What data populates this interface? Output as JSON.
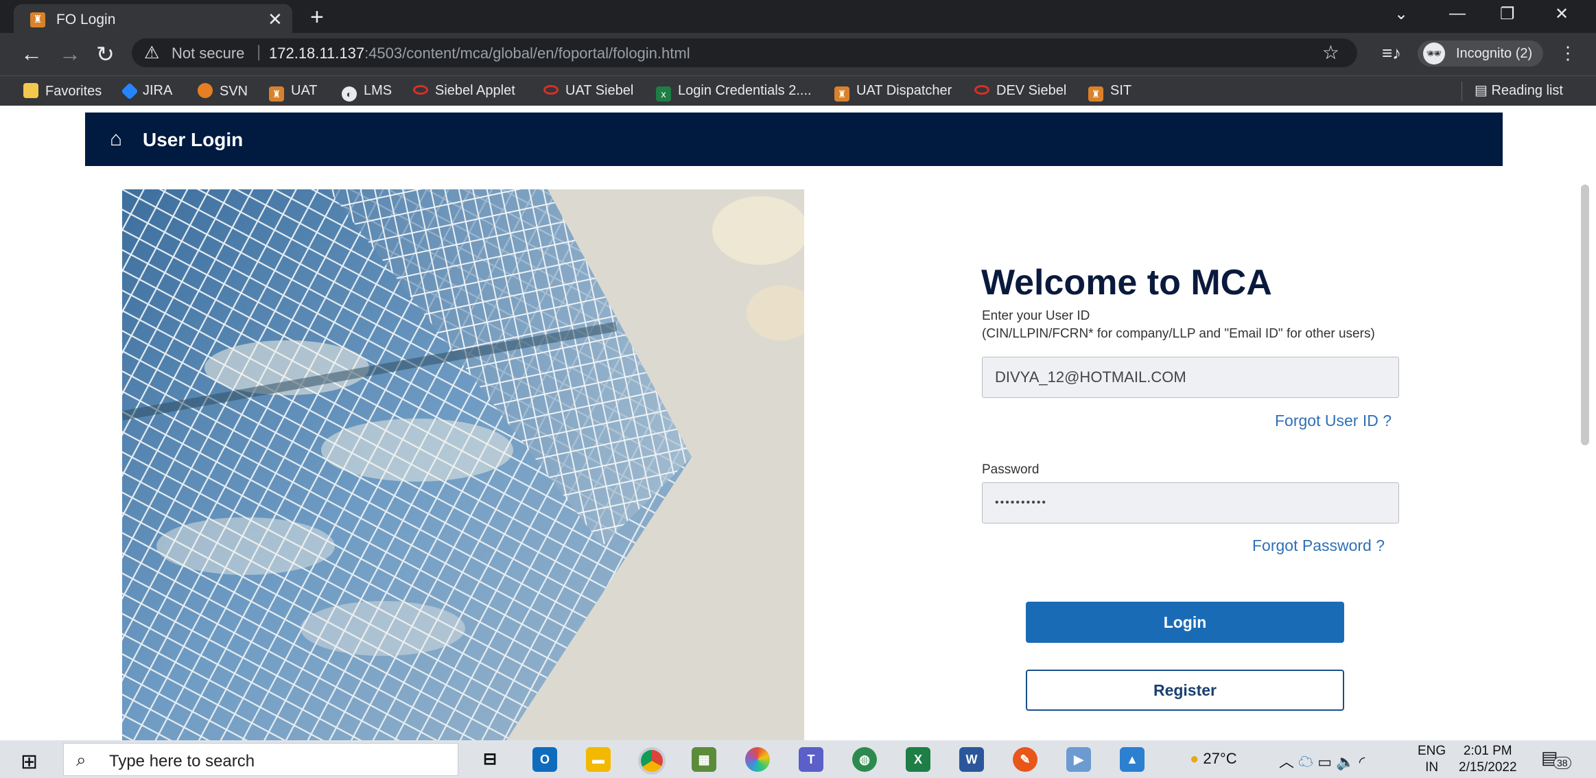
{
  "browser": {
    "tab_title": "FO Login",
    "security_label": "Not secure",
    "url_host": "172.18.11.137",
    "url_rest": ":4503/content/mca/global/en/foportal/fologin.html",
    "incognito_label": "Incognito (2)",
    "reading_list": "Reading list"
  },
  "bookmarks": [
    {
      "label": "Favorites",
      "icon": "folder-icon",
      "color": "#f2c94c"
    },
    {
      "label": "JIRA",
      "icon": "jira-icon",
      "color": "#2684ff"
    },
    {
      "label": "SVN",
      "icon": "svn-icon",
      "color": "#e67e22"
    },
    {
      "label": "UAT",
      "icon": "emblem-icon",
      "color": "#d9822b"
    },
    {
      "label": "LMS",
      "icon": "globe-icon",
      "color": "#e8eaed"
    },
    {
      "label": "Siebel Applet",
      "icon": "oracle-icon",
      "color": "#d93025"
    },
    {
      "label": "UAT Siebel",
      "icon": "oracle-icon",
      "color": "#d93025"
    },
    {
      "label": "Login Credentials 2....",
      "icon": "excel-icon",
      "color": "#1e7e45"
    },
    {
      "label": "UAT Dispatcher",
      "icon": "emblem-icon",
      "color": "#d9822b"
    },
    {
      "label": "DEV Siebel",
      "icon": "oracle-icon",
      "color": "#d93025"
    },
    {
      "label": "SIT",
      "icon": "emblem-icon",
      "color": "#d9822b"
    }
  ],
  "page": {
    "header_title": "User Login",
    "welcome": "Welcome to MCA",
    "userid_hint": "Enter your User ID",
    "userid_hint2": "(CIN/LLPIN/FCRN* for company/LLP and \"Email ID\" for other users)",
    "userid_value": "DIVYA_12@HOTMAIL.COM",
    "forgot_userid": "Forgot User ID ?",
    "password_label": "Password",
    "password_value": "••••••••••",
    "forgot_password": "Forgot Password ?",
    "login_button": "Login",
    "register_button": "Register"
  },
  "taskbar": {
    "search_placeholder": "Type here to search",
    "weather": "27°C",
    "lang_top": "ENG",
    "lang_bottom": "IN",
    "time": "2:01 PM",
    "date": "2/15/2022",
    "notifications": "38"
  }
}
